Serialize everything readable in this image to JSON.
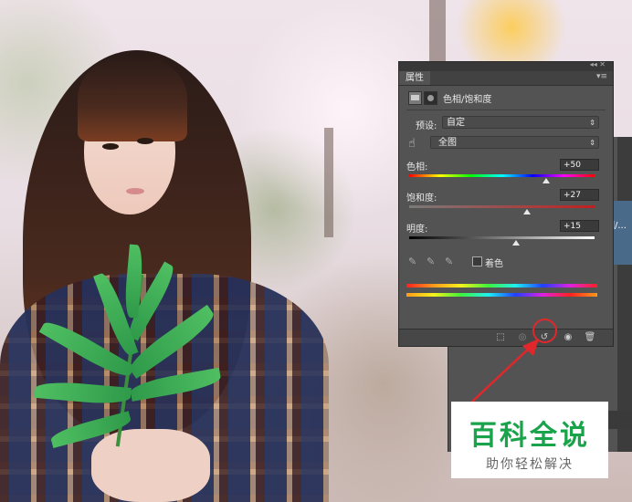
{
  "properties_panel": {
    "tab_label": "属性",
    "menu_icon": "panel-menu-icon",
    "header_title": "色相/饱和度",
    "preset_label": "预设:",
    "preset_value": "自定",
    "channel_value": "全图",
    "hue_label": "色相:",
    "hue_value": "+50",
    "saturation_label": "饱和度:",
    "saturation_value": "+27",
    "lightness_label": "明度:",
    "lightness_value": "+15",
    "colorize_label": "着色",
    "bottom_icons": [
      "clip-to-layer-icon",
      "view-previous-icon",
      "reset-icon",
      "visibility-eye-icon",
      "delete-trash-icon"
    ],
    "highlight_color": "#e0282c"
  },
  "background_panel": {
    "partial_text": "相/..."
  },
  "watermark": {
    "title": "百科全说",
    "subtitle": "助你轻松解决",
    "title_color": "#19a34a"
  }
}
